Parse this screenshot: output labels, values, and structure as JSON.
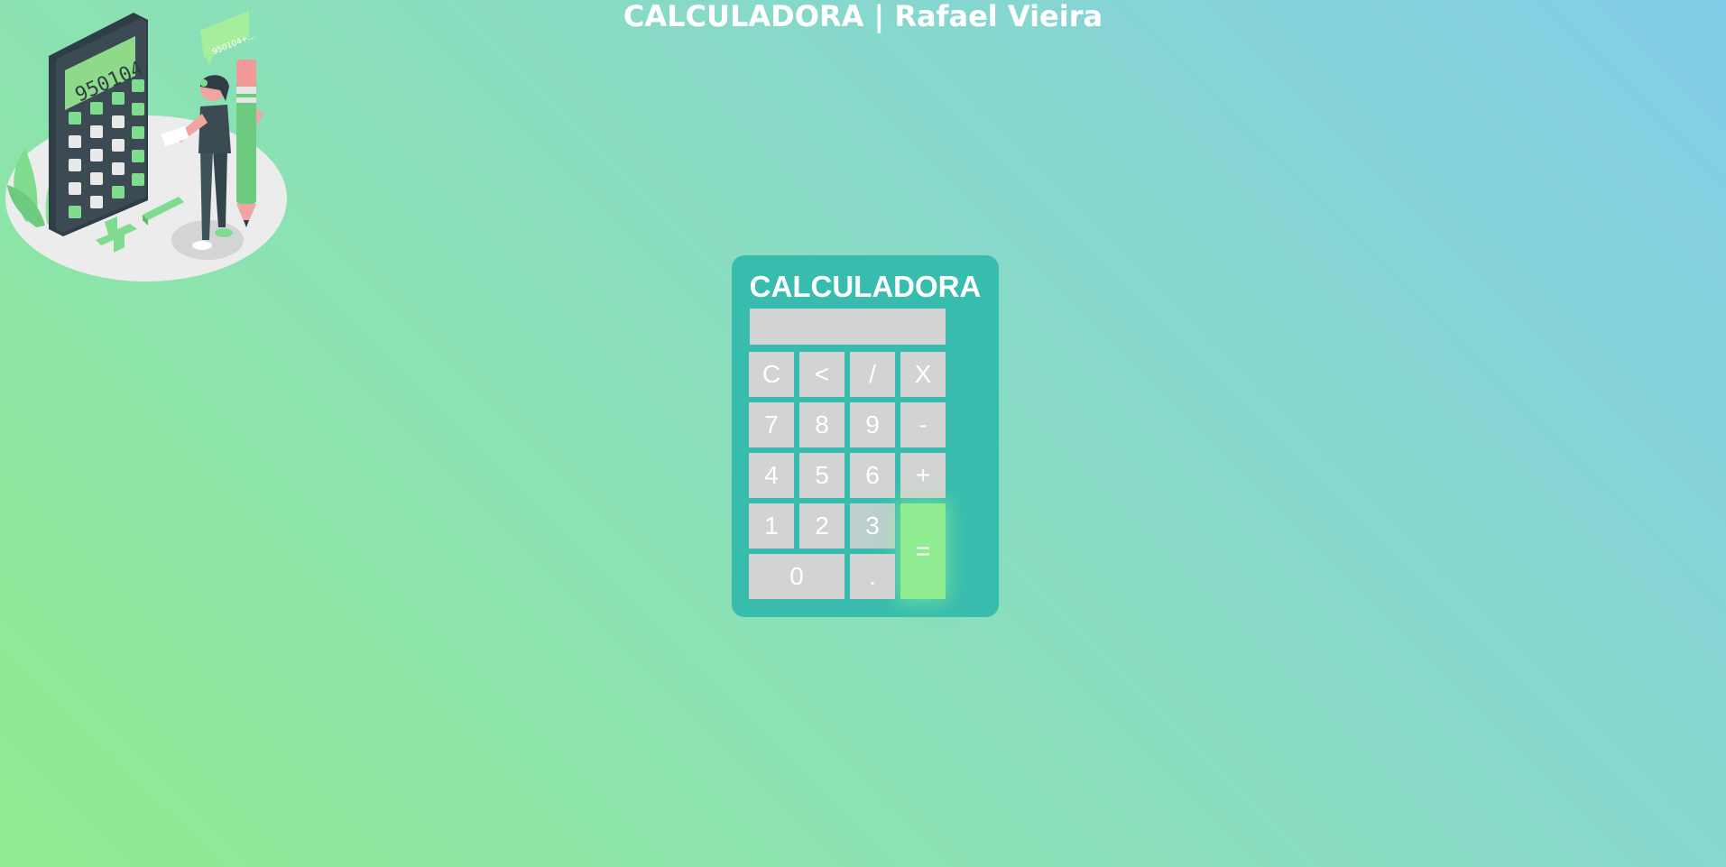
{
  "header": {
    "title": "CALCULADORA | Rafael Vieira"
  },
  "illustration": {
    "device_display": "950104",
    "bubble_text": "950104+..."
  },
  "calculator": {
    "title": "CALCULADORA",
    "display_value": "",
    "keys": {
      "clear": "C",
      "backspace": "<",
      "divide": "/",
      "multiply": "X",
      "seven": "7",
      "eight": "8",
      "nine": "9",
      "minus": "-",
      "four": "4",
      "five": "5",
      "six": "6",
      "plus": "+",
      "one": "1",
      "two": "2",
      "three": "3",
      "equals": "=",
      "zero": "0",
      "decimal": "."
    }
  },
  "colors": {
    "calculator_body": "#38bcae",
    "key": "#d3d3d3",
    "equals_key": "#90ec90",
    "accent_green": "#7fdc8f"
  }
}
